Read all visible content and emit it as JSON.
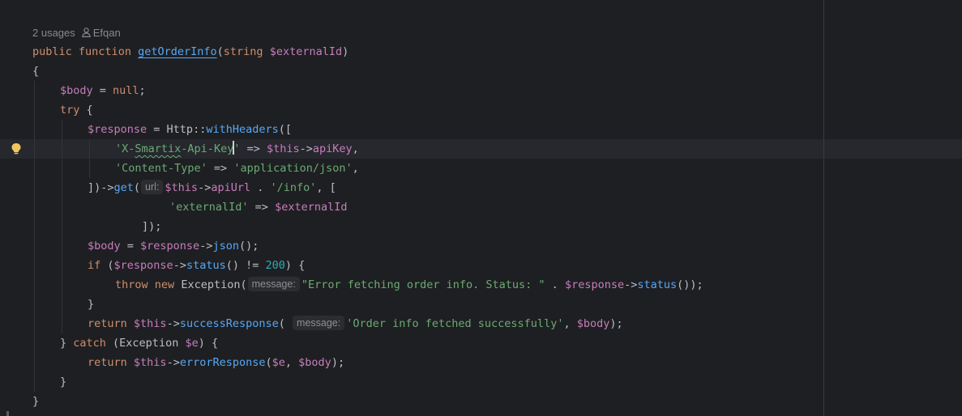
{
  "inlay": {
    "usages": "2 usages",
    "author": "Efqan",
    "url_hint": "url:",
    "message_hint_1": "message:",
    "message_hint_2": "message:"
  },
  "code": {
    "l1_kw1": "public",
    "l1_kw2": "function",
    "l1_fn": "getOrderInfo",
    "l1_type": "string",
    "l1_param": "$externalId",
    "l2": "{",
    "l3_var": "$body",
    "l3_rest": " = ",
    "l3_null": "null",
    "l3_end": ";",
    "l4_kw": "try",
    "l4_brace": " {",
    "l5_var": "$response",
    "l5_eq": " = ",
    "l5_cls": "Http",
    "l5_sep": "::",
    "l5_fn": "withHeaders",
    "l5_end": "([",
    "l6_str_a": "'X-",
    "l6_str_b": "Smartix",
    "l6_str_c": "-Api-",
    "l6_str_d": "Key",
    "l6_str_e": "'",
    "l6_arrow": " => ",
    "l6_this": "$this",
    "l6_op": "->",
    "l6_prop": "apiKey",
    "l6_comma": ",",
    "l7_key": "'Content-Type'",
    "l7_arrow": " => ",
    "l7_val": "'application/json'",
    "l7_comma": ",",
    "l8_start": "])->",
    "l8_fn": "get",
    "l8_paren": "(",
    "l8_this": "$this",
    "l8_op": "->",
    "l8_prop": "apiUrl",
    "l8_dot": " . ",
    "l8_str": "'/info'",
    "l8_end": ", [",
    "l9_key": "'externalId'",
    "l9_arrow": " => ",
    "l9_var": "$externalId",
    "l10": "]);",
    "l11_var": "$body",
    "l11_eq": " = ",
    "l11_resp": "$response",
    "l11_op": "->",
    "l11_fn": "json",
    "l11_end": "();",
    "l12_kw": "if",
    "l12_open": " (",
    "l12_resp": "$response",
    "l12_op": "->",
    "l12_fn": "status",
    "l12_neq": "() != ",
    "l12_num": "200",
    "l12_end": ") {",
    "l13_kw1": "throw",
    "l13_kw2": "new",
    "l13_cls": "Exception",
    "l13_paren": "(",
    "l13_str": "\"Error fetching order info. Status: \"",
    "l13_dot": " . ",
    "l13_resp": "$response",
    "l13_op": "->",
    "l13_fn": "status",
    "l13_end": "());",
    "l14": "}",
    "l15_kw": "return",
    "l15_this": "$this",
    "l15_op": "->",
    "l15_fn": "successResponse",
    "l15_paren": "(",
    "l15_str": "'Order info fetched successfully'",
    "l15_comma": ", ",
    "l15_body": "$body",
    "l15_end": ");",
    "l16_close": "} ",
    "l16_kw": "catch",
    "l16_open": " (",
    "l16_cls": "Exception",
    "l16_var": "$e",
    "l16_end": ") {",
    "l17_kw": "return",
    "l17_this": "$this",
    "l17_op": "->",
    "l17_fn": "errorResponse",
    "l17_paren": "(",
    "l17_e": "$e",
    "l17_comma": ", ",
    "l17_body": "$body",
    "l17_end": ");",
    "l18": "}",
    "l19": "}"
  },
  "colors": {
    "background": "#1e1f22",
    "keyword": "#cf8e6d",
    "function": "#56a8f5",
    "variable": "#c77dbb",
    "string": "#6aab73",
    "number": "#2aacb8",
    "text": "#bcbec4"
  },
  "icons": [
    "person-icon",
    "lightbulb-icon"
  ]
}
